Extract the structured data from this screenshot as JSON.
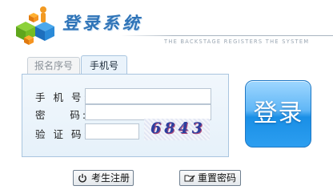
{
  "header": {
    "title": "登录系统",
    "tagline": "THE BACKSTAGE REGISTERS THE SYSTEM",
    "logo_icon": "colored-cubes-logo"
  },
  "tabs": [
    {
      "label": "报名序号",
      "active": false
    },
    {
      "label": "手机号",
      "active": true
    }
  ],
  "form": {
    "phone_label": "手 机 号:",
    "password_label": "密    码:",
    "captcha_label": "验 证 码:",
    "phone_value": "",
    "password_value": "",
    "captcha_value": "",
    "captcha_text": "6843"
  },
  "buttons": {
    "login": "登录",
    "register": "考生注册",
    "reset_password": "重置密码",
    "register_icon": "power-icon",
    "reset_icon": "folder-edit-icon"
  },
  "colors": {
    "accent": "#2f74b8",
    "login_button": "#1a8fe6",
    "panel_border": "#a9c5df"
  }
}
